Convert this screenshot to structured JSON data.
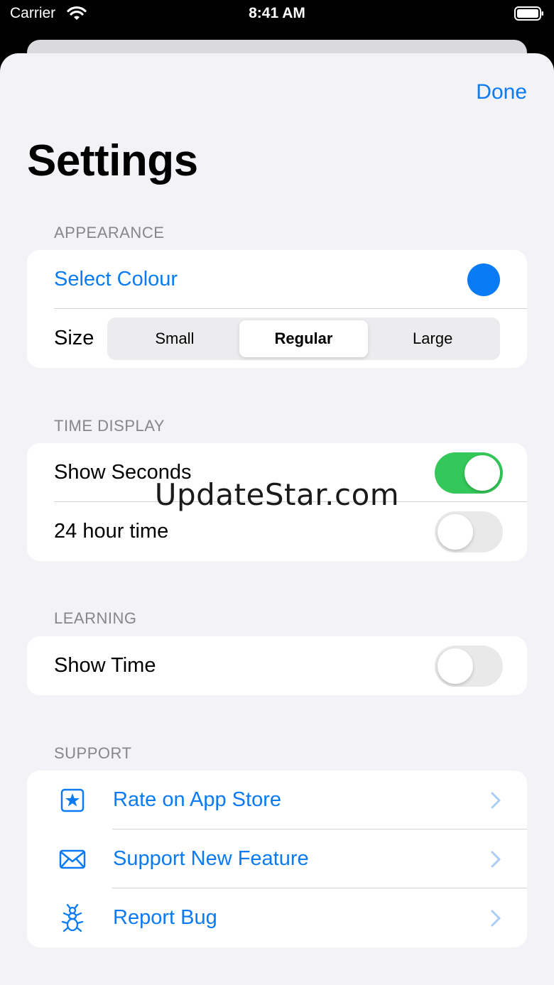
{
  "status_bar": {
    "carrier": "Carrier",
    "time": "8:41 AM"
  },
  "header": {
    "done_label": "Done",
    "title": "Settings"
  },
  "sections": {
    "appearance": {
      "header": "APPEARANCE",
      "select_colour_label": "Select Colour",
      "selected_colour": "#0a7bf5",
      "size_label": "Size",
      "size_options": [
        "Small",
        "Regular",
        "Large"
      ],
      "size_selected": "Regular"
    },
    "time_display": {
      "header": "TIME DISPLAY",
      "show_seconds_label": "Show Seconds",
      "show_seconds_on": true,
      "hour24_label": "24 hour time",
      "hour24_on": false
    },
    "learning": {
      "header": "LEARNING",
      "show_time_label": "Show Time",
      "show_time_on": false
    },
    "support": {
      "header": "SUPPORT",
      "items": [
        {
          "label": "Rate on App Store",
          "icon": "star-square-icon"
        },
        {
          "label": "Support New Feature",
          "icon": "envelope-icon"
        },
        {
          "label": "Report Bug",
          "icon": "ant-icon"
        }
      ]
    }
  },
  "watermark": "UpdateStar.com",
  "colors": {
    "accent": "#0a7bf5",
    "toggle_on": "#34c759",
    "background": "#f2f2f7"
  }
}
